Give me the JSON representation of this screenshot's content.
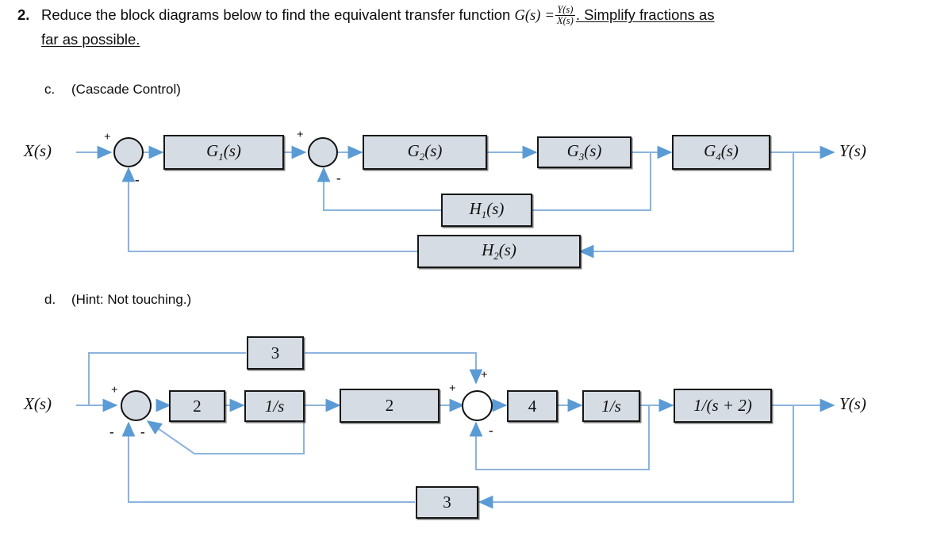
{
  "question": {
    "number": "2.",
    "text_before_fraction": "Reduce the block diagrams below to find the equivalent transfer function ",
    "gs": "G(s)",
    "equals": "=",
    "fraction_numerator": "Y(s)",
    "fraction_denominator": "X(s)",
    "text_after_fraction": ". Simplify fractions as",
    "second_line": "far as possible."
  },
  "parts": [
    {
      "letter": "c.",
      "title": "(Cascade Control)"
    },
    {
      "letter": "d.",
      "title": "(Hint: Not touching.)"
    }
  ],
  "diagram_c": {
    "input_label": "X(s)",
    "output_label": "Y(s)",
    "blocks": [
      {
        "label": "G1(s)",
        "base": "G",
        "sub": "1",
        "tail": "(s)"
      },
      {
        "label": "G2(s)",
        "base": "G",
        "sub": "2",
        "tail": "(s)"
      },
      {
        "label": "G3(s)",
        "base": "G",
        "sub": "3",
        "tail": "(s)"
      },
      {
        "label": "G4(s)",
        "base": "G",
        "sub": "4",
        "tail": "(s)"
      },
      {
        "label": "H1(s)",
        "base": "H",
        "sub": "1",
        "tail": "(s)"
      },
      {
        "label": "H2(s)",
        "base": "H",
        "sub": "2",
        "tail": "(s)"
      }
    ],
    "summing_junctions": [
      {
        "name": "sum-1",
        "signs": [
          "+",
          "-"
        ]
      },
      {
        "name": "sum-2",
        "signs": [
          "+",
          "-"
        ]
      }
    ]
  },
  "diagram_d": {
    "input_label": "X(s)",
    "output_label": "Y(s)",
    "blocks": [
      {
        "name": "feedforward-gain-3",
        "label": "3"
      },
      {
        "name": "gain-2-a",
        "label": "2"
      },
      {
        "name": "integrator-a",
        "label": "1/s"
      },
      {
        "name": "gain-2-b",
        "label": "2"
      },
      {
        "name": "gain-4",
        "label": "4"
      },
      {
        "name": "integrator-b",
        "label": "1/s"
      },
      {
        "name": "lag-block",
        "label": "1/(s + 2)"
      },
      {
        "name": "feedback-gain-3",
        "label": "3"
      }
    ],
    "summing_junctions": [
      {
        "name": "sum-1",
        "signs": [
          "+",
          "-",
          "-"
        ]
      },
      {
        "name": "sum-2",
        "signs": [
          "+",
          "+",
          "-"
        ]
      }
    ]
  },
  "colors": {
    "block_fill": "#d6dce4",
    "block_border": "#161616",
    "wire": "#8cb4dd",
    "arrow": "#5b9bd5",
    "text": "#0d0d0d"
  }
}
